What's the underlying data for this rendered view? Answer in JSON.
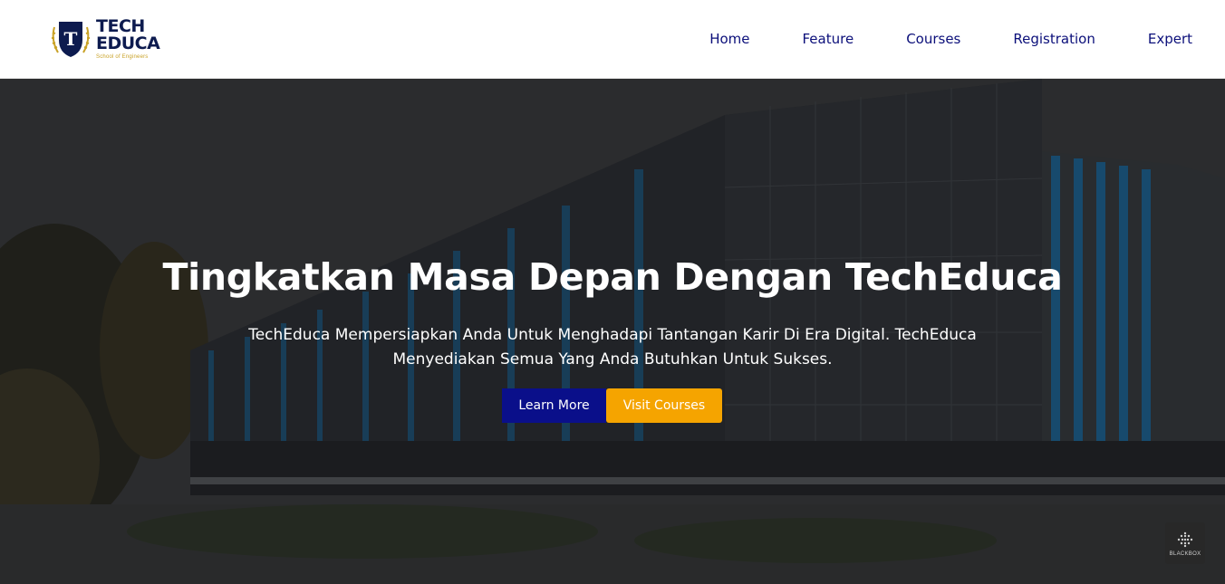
{
  "brand": {
    "line1": "TECH",
    "line2": "EDUCA",
    "tagline": "School of Engineers",
    "emblem_letter": "T",
    "colors": {
      "navy": "#0d1b4f",
      "gold": "#c9a227"
    }
  },
  "nav": {
    "items": [
      {
        "label": "Home"
      },
      {
        "label": "Feature"
      },
      {
        "label": "Courses"
      },
      {
        "label": "Registration"
      },
      {
        "label": "Expert"
      }
    ],
    "color": "#0b0f7a"
  },
  "hero": {
    "title": "Tingkatkan Masa Depan Dengan TechEduca",
    "description": "TechEduca Mempersiapkan Anda Untuk Menghadapi Tantangan Karir Di Era Digital. TechEduca Menyediakan Semua Yang Anda Butuhkan Untuk Sukses.",
    "primary_button": "Learn More",
    "secondary_button": "Visit Courses",
    "background_icon": "building-photo",
    "colors": {
      "primary": "#0a0f8a",
      "secondary": "#f5a400"
    }
  },
  "badge": {
    "label": "BLACKBOX",
    "icon": "blackbox-logo-icon"
  }
}
